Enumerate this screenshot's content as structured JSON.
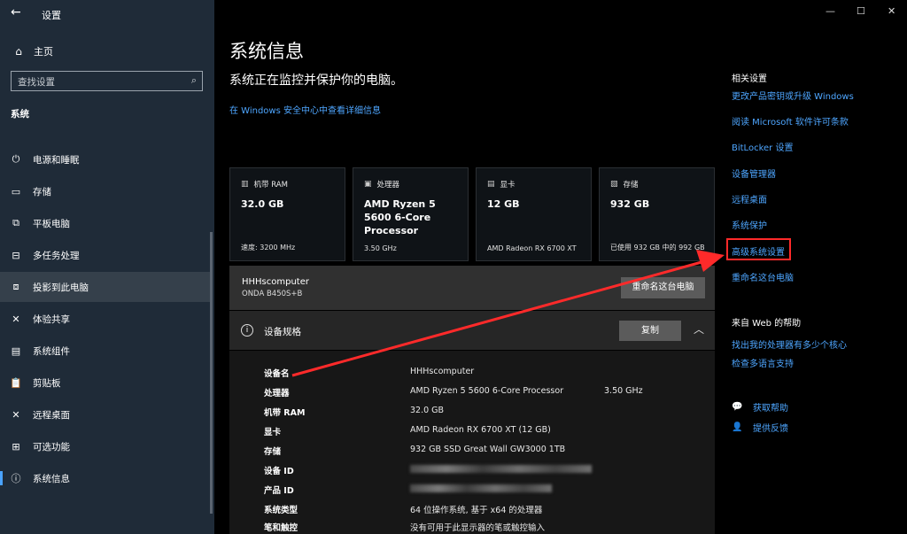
{
  "window": {
    "app_title": "设置",
    "minimize": "—",
    "maximize": "☐",
    "close": "✕"
  },
  "sidebar": {
    "home_label": "主页",
    "search_placeholder": "查找设置",
    "section": "系统",
    "items": [
      {
        "label": "电源和睡眠",
        "icon": "⏻"
      },
      {
        "label": "存储",
        "icon": "▭"
      },
      {
        "label": "平板电脑",
        "icon": "⧉"
      },
      {
        "label": "多任务处理",
        "icon": "⊟"
      },
      {
        "label": "投影到此电脑",
        "icon": "⧈"
      },
      {
        "label": "体验共享",
        "icon": "✕"
      },
      {
        "label": "系统组件",
        "icon": "▤"
      },
      {
        "label": "剪贴板",
        "icon": "📋"
      },
      {
        "label": "远程桌面",
        "icon": "✕"
      },
      {
        "label": "可选功能",
        "icon": "⊞"
      },
      {
        "label": "系统信息",
        "icon": "ⓘ"
      }
    ]
  },
  "main": {
    "title": "系统信息",
    "subtitle": "系统正在监控并保护你的电脑。",
    "security_link": "在 Windows 安全中心中查看详细信息",
    "cards": [
      {
        "caption": "机带 RAM",
        "value": "32.0 GB",
        "sub": "速度: 3200 MHz",
        "icon": "▥"
      },
      {
        "caption": "处理器",
        "value": "AMD Ryzen 5 5600 6-Core Processor",
        "sub": "3.50 GHz",
        "icon": "▣"
      },
      {
        "caption": "显卡",
        "value": "12 GB",
        "sub": "AMD Radeon RX 6700 XT",
        "icon": "▤"
      },
      {
        "caption": "存储",
        "value": "932 GB",
        "sub": "已使用 932 GB 中的 992 GB",
        "icon": "▧"
      }
    ],
    "pc": {
      "name": "HHHscomputer",
      "board": "ONDA B450S+B",
      "rename_label": "重命名这台电脑"
    },
    "specs": {
      "title": "设备规格",
      "copy_label": "复制",
      "rows": [
        {
          "key": "设备名",
          "value": "HHHscomputer",
          "value2": ""
        },
        {
          "key": "处理器",
          "value": "AMD Ryzen 5 5600 6-Core Processor",
          "value2": "3.50 GHz"
        },
        {
          "key": "机带 RAM",
          "value": "32.0 GB",
          "value2": ""
        },
        {
          "key": "显卡",
          "value": "AMD Radeon RX 6700 XT (12 GB)",
          "value2": ""
        },
        {
          "key": "存储",
          "value": "932 GB SSD Great Wall GW3000 1TB",
          "value2": ""
        },
        {
          "key": "设备 ID",
          "value": "",
          "value2": ""
        },
        {
          "key": "产品 ID",
          "value": "",
          "value2": ""
        },
        {
          "key": "系统类型",
          "value": "64 位操作系统, 基于 x64 的处理器",
          "value2": ""
        },
        {
          "key": "笔和触控",
          "value": "没有可用于此显示器的笔或触控输入",
          "value2": ""
        }
      ]
    }
  },
  "related": {
    "title": "相关设置",
    "links": [
      "更改产品密钥或升级 Windows",
      "阅读 Microsoft 软件许可条款",
      "BitLocker 设置",
      "设备管理器",
      "远程桌面",
      "系统保护",
      "高级系统设置",
      "重命名这台电脑"
    ]
  },
  "help": {
    "title": "来自 Web 的帮助",
    "links": [
      "找出我的处理器有多少个核心",
      "检查多语言支持"
    ],
    "get_help": "获取帮助",
    "feedback": "提供反馈"
  },
  "colors": {
    "accent": "#4ea6ff",
    "sidebar_bg": "#1f2b38",
    "annotation": "#ff2a2a"
  }
}
